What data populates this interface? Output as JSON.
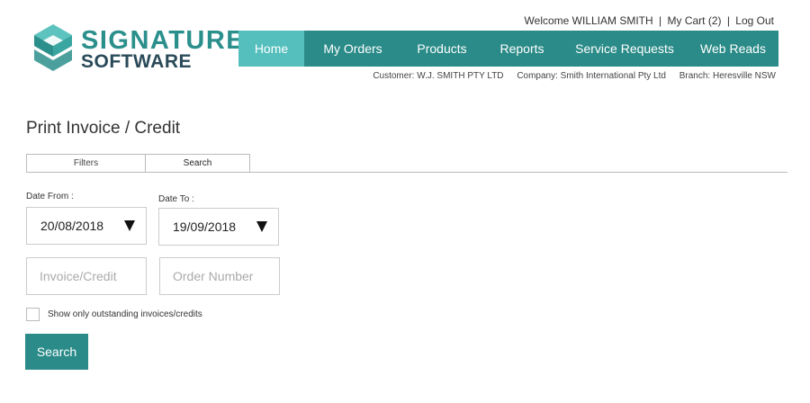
{
  "brand": {
    "line1": "SIGNATURE",
    "line2": "SOFTWARE",
    "accent_color": "#2b8f8c",
    "dark_color": "#2a4a5a",
    "icon": "logo-cube-icon"
  },
  "user_links": {
    "welcome": "Welcome WILLIAM SMITH",
    "cart": "My Cart (2)",
    "logout": "Log Out",
    "separator": "|"
  },
  "nav": {
    "color": "#2a8b88",
    "active_color": "#54bfbd",
    "items": [
      {
        "label": "Home"
      },
      {
        "label": "My Orders"
      },
      {
        "label": "Products"
      },
      {
        "label": "Reports"
      },
      {
        "label": "Service Requests"
      },
      {
        "label": "Web Reads"
      }
    ],
    "active_index": 0
  },
  "customer_info": {
    "customer": "Customer: W.J. SMITH PTY LTD",
    "company": "Company: Smith International Pty Ltd",
    "branch": "Branch: Heresville NSW"
  },
  "page": {
    "title": "Print Invoice / Credit"
  },
  "tabs": [
    {
      "label": "Filters"
    },
    {
      "label": "Search"
    }
  ],
  "form": {
    "date_from_label": "Date From :",
    "date_from_value": "20/08/2018",
    "date_to_label": "Date To :",
    "date_to_value": "19/09/2018",
    "dropdown_icon": "triangle-down-icon",
    "invoice_placeholder": "Invoice/Credit",
    "invoice_value": "",
    "order_placeholder": "Order Number",
    "order_value": "",
    "outstanding_label": "Show only outstanding invoices/credits",
    "outstanding_checked": false,
    "search_button": "Search"
  }
}
